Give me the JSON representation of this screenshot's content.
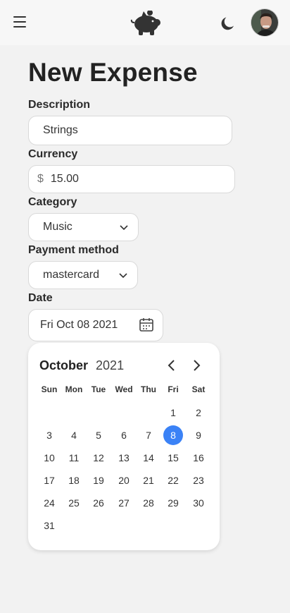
{
  "header": {
    "menu_icon": "hamburger-menu-icon",
    "logo_icon": "piggy-bank-icon",
    "theme_icon": "moon-icon",
    "avatar": "user-avatar"
  },
  "page_title": "New Expense",
  "form": {
    "description_label": "Description",
    "description_value": "Strings",
    "currency_label": "Currency",
    "currency_symbol": "$",
    "currency_value": "15.00",
    "category_label": "Category",
    "category_value": "Music",
    "payment_label": "Payment method",
    "payment_value": "mastercard",
    "date_label": "Date",
    "date_value": "Fri Oct 08 2021"
  },
  "calendar": {
    "month": "October",
    "year": "2021",
    "weekdays": [
      "Sun",
      "Mon",
      "Tue",
      "Wed",
      "Thu",
      "Fri",
      "Sat"
    ],
    "first_weekday_index": 5,
    "days_in_month": 31,
    "selected_day": 8,
    "accent_color": "#3b82f6"
  }
}
